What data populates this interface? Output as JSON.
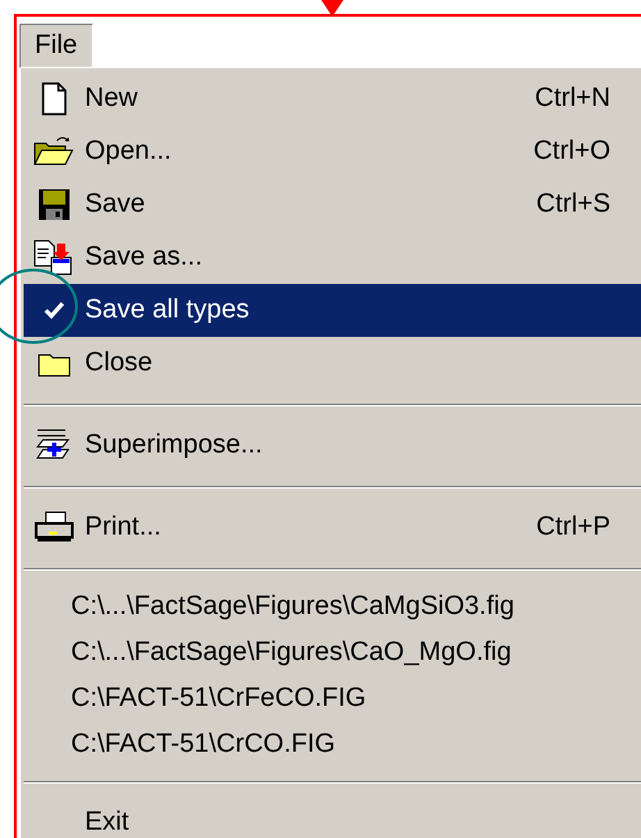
{
  "menu_bar": [
    {
      "label": "File",
      "selected": true
    }
  ],
  "menu": [
    {
      "kind": "command",
      "label": "New",
      "shortcut": "Ctrl+N",
      "checked": false,
      "selected": false
    },
    {
      "kind": "command",
      "label": "Open...",
      "shortcut": "Ctrl+O",
      "checked": false,
      "selected": false
    },
    {
      "kind": "command",
      "label": "Save",
      "shortcut": "Ctrl+S",
      "checked": false,
      "selected": false
    },
    {
      "kind": "command",
      "label": "Save as...",
      "checked": false,
      "selected": false
    },
    {
      "kind": "command",
      "label": "Save all types",
      "checked": true,
      "selected": true
    },
    {
      "kind": "command",
      "label": "Close",
      "checked": false,
      "selected": false
    },
    {
      "kind": "separator"
    },
    {
      "kind": "command",
      "label": "Superimpose...",
      "checked": false,
      "selected": false
    },
    {
      "kind": "separator"
    },
    {
      "kind": "command",
      "label": "Print...",
      "shortcut": "Ctrl+P",
      "checked": false,
      "selected": false
    },
    {
      "kind": "separator"
    },
    {
      "kind": "recent_file",
      "label": "C:\\...\\FactSage\\Figures\\CaMgSiO3.fig",
      "selected": false
    },
    {
      "kind": "recent_file",
      "label": "C:\\...\\FactSage\\Figures\\CaO_MgO.fig",
      "selected": false
    },
    {
      "kind": "recent_file",
      "label": "C:\\FACT-51\\CrFeCO.FIG",
      "selected": false
    },
    {
      "kind": "recent_file",
      "label": "C:\\FACT-51\\CrCO.FIG",
      "selected": false
    },
    {
      "kind": "separator"
    },
    {
      "kind": "command",
      "label": "Exit",
      "selected": false
    }
  ]
}
